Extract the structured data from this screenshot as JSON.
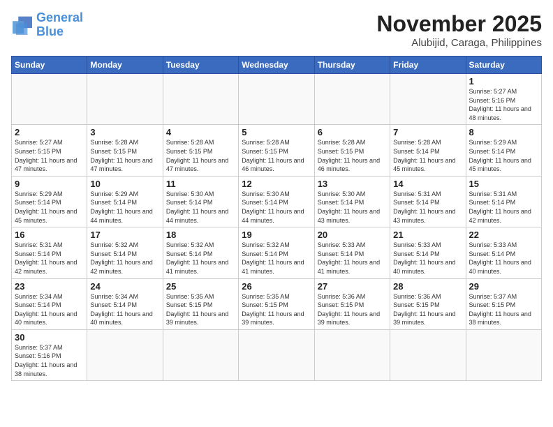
{
  "logo": {
    "general": "General",
    "blue": "Blue"
  },
  "header": {
    "month": "November 2025",
    "location": "Alubijid, Caraga, Philippines"
  },
  "weekdays": [
    "Sunday",
    "Monday",
    "Tuesday",
    "Wednesday",
    "Thursday",
    "Friday",
    "Saturday"
  ],
  "days": {
    "1": {
      "sunrise": "5:27 AM",
      "sunset": "5:16 PM",
      "daylight": "11 hours and 48 minutes."
    },
    "2": {
      "sunrise": "5:27 AM",
      "sunset": "5:15 PM",
      "daylight": "11 hours and 47 minutes."
    },
    "3": {
      "sunrise": "5:28 AM",
      "sunset": "5:15 PM",
      "daylight": "11 hours and 47 minutes."
    },
    "4": {
      "sunrise": "5:28 AM",
      "sunset": "5:15 PM",
      "daylight": "11 hours and 47 minutes."
    },
    "5": {
      "sunrise": "5:28 AM",
      "sunset": "5:15 PM",
      "daylight": "11 hours and 46 minutes."
    },
    "6": {
      "sunrise": "5:28 AM",
      "sunset": "5:15 PM",
      "daylight": "11 hours and 46 minutes."
    },
    "7": {
      "sunrise": "5:28 AM",
      "sunset": "5:14 PM",
      "daylight": "11 hours and 45 minutes."
    },
    "8": {
      "sunrise": "5:29 AM",
      "sunset": "5:14 PM",
      "daylight": "11 hours and 45 minutes."
    },
    "9": {
      "sunrise": "5:29 AM",
      "sunset": "5:14 PM",
      "daylight": "11 hours and 45 minutes."
    },
    "10": {
      "sunrise": "5:29 AM",
      "sunset": "5:14 PM",
      "daylight": "11 hours and 44 minutes."
    },
    "11": {
      "sunrise": "5:30 AM",
      "sunset": "5:14 PM",
      "daylight": "11 hours and 44 minutes."
    },
    "12": {
      "sunrise": "5:30 AM",
      "sunset": "5:14 PM",
      "daylight": "11 hours and 44 minutes."
    },
    "13": {
      "sunrise": "5:30 AM",
      "sunset": "5:14 PM",
      "daylight": "11 hours and 43 minutes."
    },
    "14": {
      "sunrise": "5:31 AM",
      "sunset": "5:14 PM",
      "daylight": "11 hours and 43 minutes."
    },
    "15": {
      "sunrise": "5:31 AM",
      "sunset": "5:14 PM",
      "daylight": "11 hours and 42 minutes."
    },
    "16": {
      "sunrise": "5:31 AM",
      "sunset": "5:14 PM",
      "daylight": "11 hours and 42 minutes."
    },
    "17": {
      "sunrise": "5:32 AM",
      "sunset": "5:14 PM",
      "daylight": "11 hours and 42 minutes."
    },
    "18": {
      "sunrise": "5:32 AM",
      "sunset": "5:14 PM",
      "daylight": "11 hours and 41 minutes."
    },
    "19": {
      "sunrise": "5:32 AM",
      "sunset": "5:14 PM",
      "daylight": "11 hours and 41 minutes."
    },
    "20": {
      "sunrise": "5:33 AM",
      "sunset": "5:14 PM",
      "daylight": "11 hours and 41 minutes."
    },
    "21": {
      "sunrise": "5:33 AM",
      "sunset": "5:14 PM",
      "daylight": "11 hours and 40 minutes."
    },
    "22": {
      "sunrise": "5:33 AM",
      "sunset": "5:14 PM",
      "daylight": "11 hours and 40 minutes."
    },
    "23": {
      "sunrise": "5:34 AM",
      "sunset": "5:14 PM",
      "daylight": "11 hours and 40 minutes."
    },
    "24": {
      "sunrise": "5:34 AM",
      "sunset": "5:14 PM",
      "daylight": "11 hours and 40 minutes."
    },
    "25": {
      "sunrise": "5:35 AM",
      "sunset": "5:15 PM",
      "daylight": "11 hours and 39 minutes."
    },
    "26": {
      "sunrise": "5:35 AM",
      "sunset": "5:15 PM",
      "daylight": "11 hours and 39 minutes."
    },
    "27": {
      "sunrise": "5:36 AM",
      "sunset": "5:15 PM",
      "daylight": "11 hours and 39 minutes."
    },
    "28": {
      "sunrise": "5:36 AM",
      "sunset": "5:15 PM",
      "daylight": "11 hours and 39 minutes."
    },
    "29": {
      "sunrise": "5:37 AM",
      "sunset": "5:15 PM",
      "daylight": "11 hours and 38 minutes."
    },
    "30": {
      "sunrise": "5:37 AM",
      "sunset": "5:16 PM",
      "daylight": "11 hours and 38 minutes."
    }
  },
  "labels": {
    "sunrise": "Sunrise:",
    "sunset": "Sunset:",
    "daylight": "Daylight:"
  }
}
